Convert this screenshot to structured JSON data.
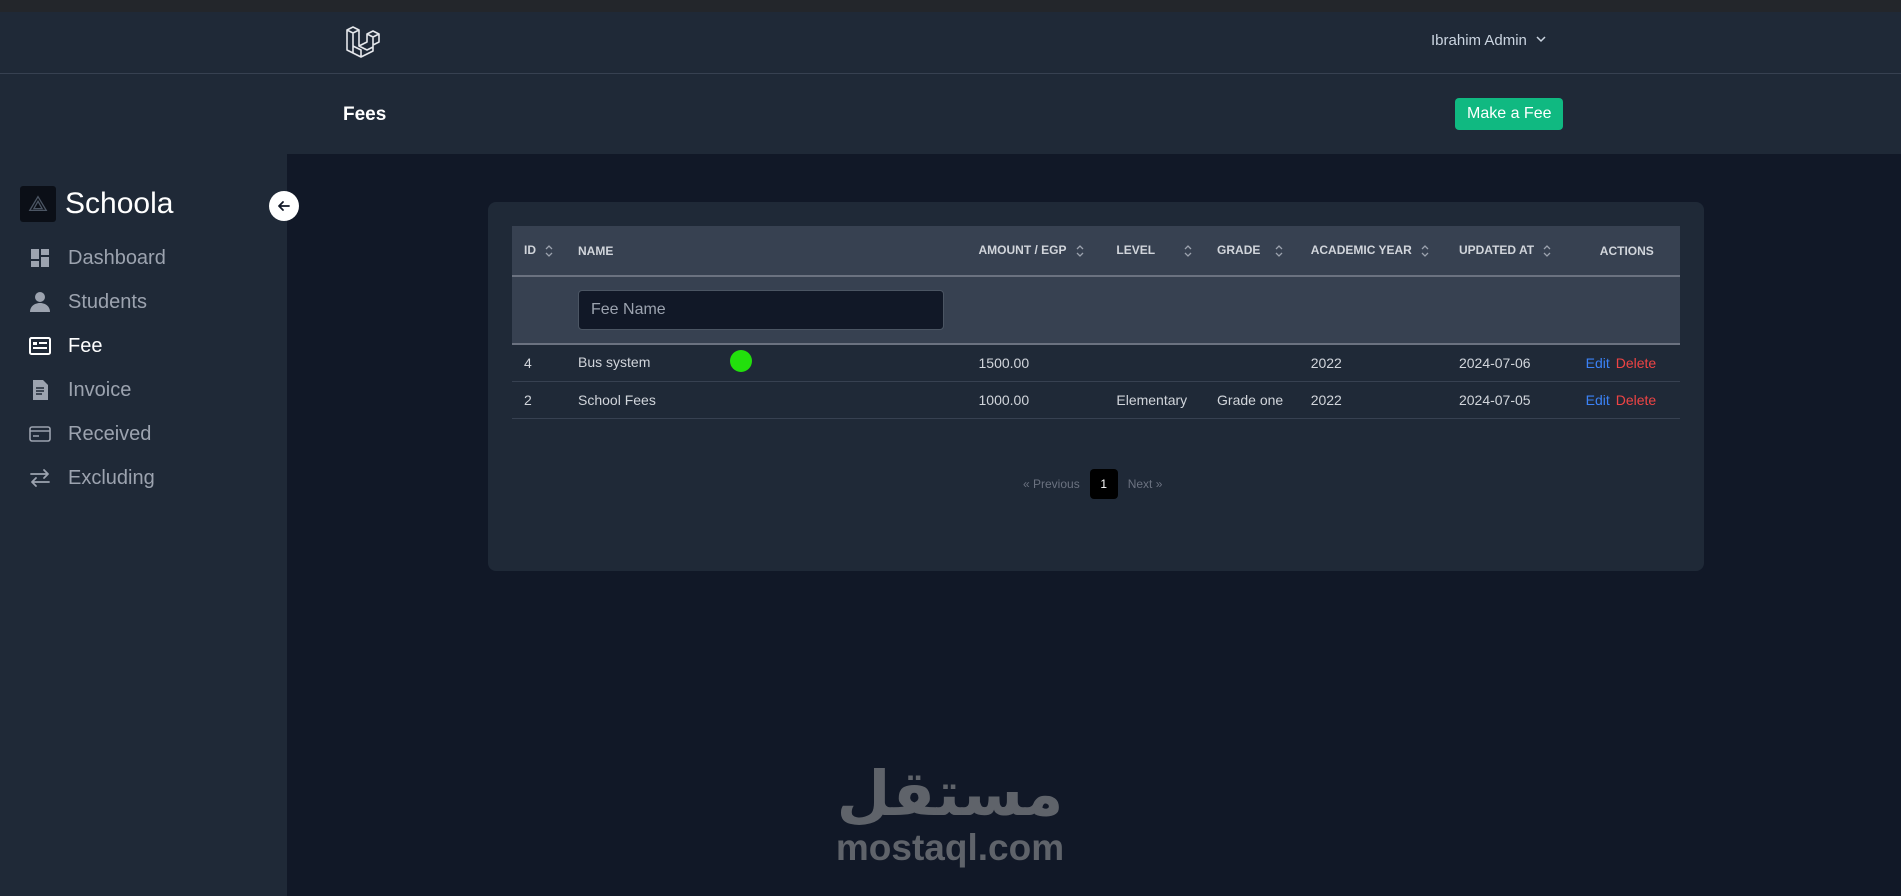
{
  "navbar": {
    "user_name": "Ibrahim Admin"
  },
  "header": {
    "title": "Fees",
    "make_fee_label": "Make a Fee"
  },
  "sidebar": {
    "brand": "Schoola",
    "items": [
      {
        "label": "Dashboard",
        "icon": "dashboard-icon",
        "active": false
      },
      {
        "label": "Students",
        "icon": "user-icon",
        "active": false
      },
      {
        "label": "Fee",
        "icon": "fee-icon",
        "active": true
      },
      {
        "label": "Invoice",
        "icon": "invoice-icon",
        "active": false
      },
      {
        "label": "Received",
        "icon": "card-icon",
        "active": false
      },
      {
        "label": "Excluding",
        "icon": "exchange-icon",
        "active": false
      }
    ]
  },
  "table": {
    "columns": [
      "ID",
      "NAME",
      "AMOUNT / EGP",
      "LEVEL",
      "GRADE",
      "ACADEMIC YEAR",
      "UPDATED AT",
      "ACTIONS"
    ],
    "filter_placeholder": "Fee Name",
    "rows": [
      {
        "id": "4",
        "name": "Bus system",
        "amount": "1500.00",
        "level": "",
        "grade": "",
        "year": "2022",
        "updated": "2024-07-06",
        "edit": "Edit",
        "delete": "Delete"
      },
      {
        "id": "2",
        "name": "School Fees",
        "amount": "1000.00",
        "level": "Elementary",
        "grade": "Grade one",
        "year": "2022",
        "updated": "2024-07-05",
        "edit": "Edit",
        "delete": "Delete"
      }
    ]
  },
  "pagination": {
    "previous": "« Previous",
    "current": "1",
    "next": "Next »"
  },
  "watermark": {
    "arabic": "مستقل",
    "latin": "mostaql.com"
  },
  "colors": {
    "background": "#111827",
    "panel": "#1f2937",
    "accent_green": "#10b981",
    "edit_blue": "#3b82f6",
    "delete_red": "#ef4444"
  }
}
